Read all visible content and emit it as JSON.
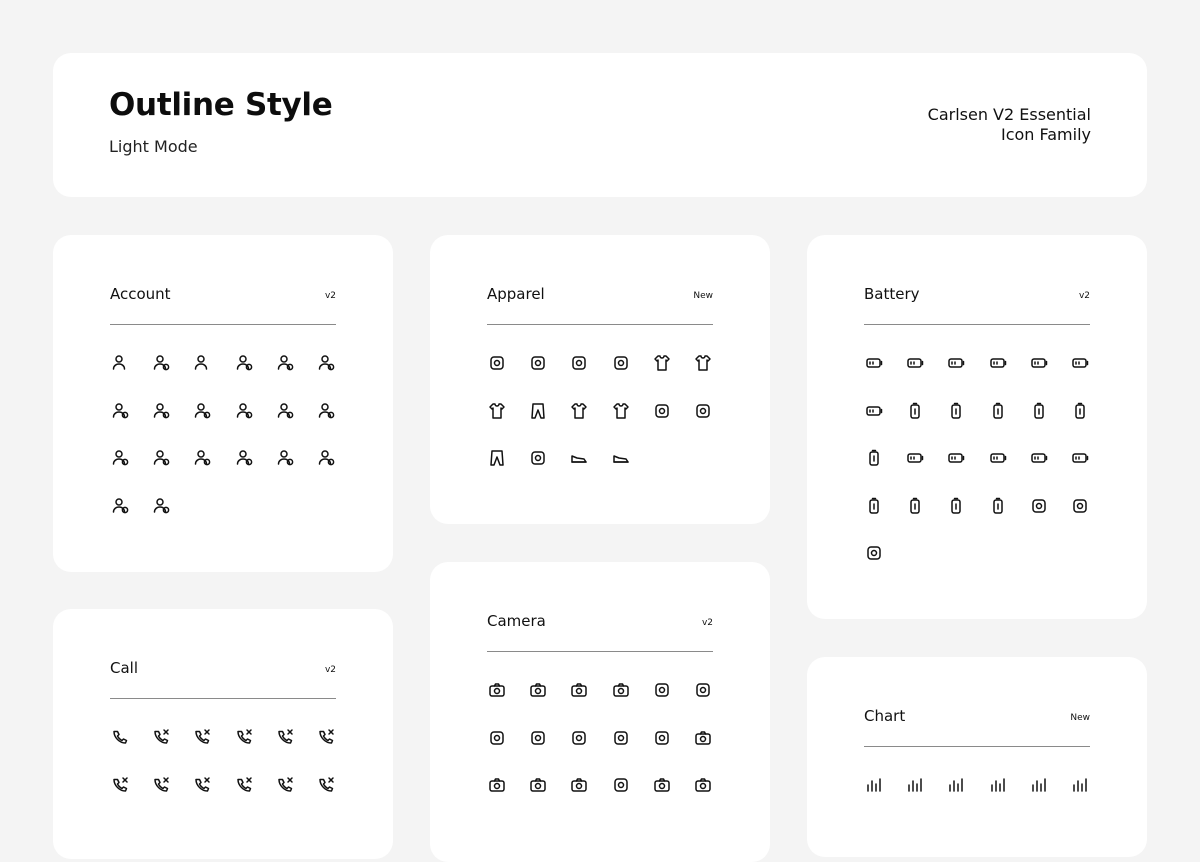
{
  "header": {
    "title": "Outline Style",
    "subtitle": "Light Mode",
    "family_line1": "Carlsen V2 Essential",
    "family_line2": "Icon Family"
  },
  "sections": {
    "account": {
      "title": "Account",
      "badge": "v2",
      "icons": [
        "user-icon",
        "users-icon",
        "user-alt-icon",
        "user-circle-icon",
        "user-share-icon",
        "user-settings-icon",
        "user-check-icon",
        "user-group-icon",
        "user-id-card-icon",
        "user-verified-icon",
        "user-search-icon",
        "user-clock-icon",
        "user-lock-icon",
        "user-gear-icon",
        "user-transfer-icon",
        "user-minus-icon",
        "user-info-icon",
        "user-sync-icon",
        "user-laptop-icon",
        "user-edit-icon"
      ]
    },
    "apparel": {
      "title": "Apparel",
      "badge": "New",
      "icons": [
        "underwear-icon",
        "cap-icon",
        "hat-icon",
        "bowtie-icon",
        "shirt-icon",
        "sweater-icon",
        "jacket-icon",
        "shorts-icon",
        "tshirt-icon",
        "top-icon",
        "belt-icon",
        "tie-icon",
        "pants-icon",
        "socks-icon",
        "shoe-icon",
        "sneaker-icon"
      ]
    },
    "battery": {
      "title": "Battery",
      "badge": "v2",
      "icons": [
        "battery-full-icon",
        "battery-half-icon",
        "battery-low-icon",
        "battery-empty-icon",
        "battery-off-icon",
        "battery-charging-icon",
        "battery-warning-icon",
        "battery-vertical-full-icon",
        "battery-vertical-half-icon",
        "battery-vertical-low-icon",
        "battery-vertical-empty-icon",
        "battery-vertical-charging-icon",
        "battery-vertical-alert-icon",
        "battery-plus-icon",
        "battery-check-icon",
        "battery-minus-icon",
        "battery-x-icon",
        "car-battery-icon",
        "battery-vertical-plus-icon",
        "battery-vertical-bolt-icon",
        "battery-vertical-minus-icon",
        "battery-vertical-x-icon",
        "solar-panel-icon",
        "eco-energy-icon",
        "plug-icon"
      ]
    },
    "call": {
      "title": "Call",
      "badge": "v2",
      "icons": [
        "phone-icon",
        "phone-off-icon",
        "phone-add-icon",
        "phone-missed-icon",
        "phone-outgoing-icon",
        "phone-incoming-icon",
        "phone-ringing-icon",
        "phone-wait-icon",
        "phone-check-icon",
        "phone-forward-icon",
        "phone-hold-icon",
        "phone-block-icon"
      ]
    },
    "camera": {
      "title": "Camera",
      "badge": "v2",
      "icons": [
        "camera-icon",
        "video-camera-icon",
        "movie-camera-icon",
        "film-icon",
        "live-icon",
        "tree-icon",
        "aperture-icon",
        "face-scan-icon",
        "focus-icon",
        "flash-icon",
        "color-filter-icon",
        "camera-plus-icon",
        "camera-minus-icon",
        "camera-check-icon",
        "gallery-icon",
        "night-mode-icon",
        "camera-off-icon",
        "video-off-icon"
      ]
    },
    "chart": {
      "title": "Chart",
      "badge": "New",
      "icons": [
        "bar-chart-icon",
        "bar-chart-alt-icon",
        "pie-chart-icon",
        "pyramid-chart-icon",
        "chart-box-icon",
        "chart-circle-icon"
      ]
    }
  },
  "colors": {
    "background": "#f4f4f4",
    "card": "#ffffff",
    "ink": "#111111",
    "rule": "#8a8a8a"
  }
}
